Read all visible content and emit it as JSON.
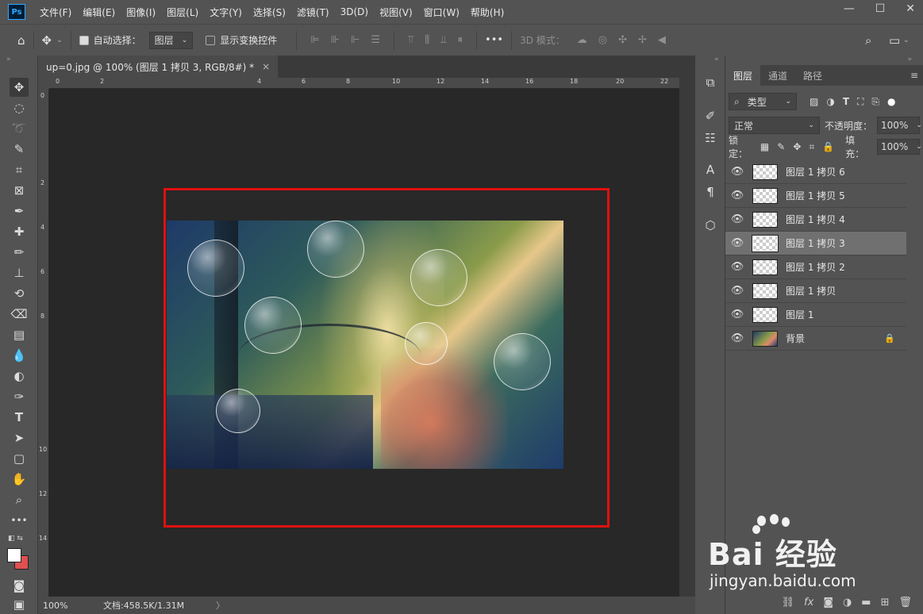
{
  "app": {
    "logo": "Ps"
  },
  "menu": [
    "文件(F)",
    "编辑(E)",
    "图像(I)",
    "图层(L)",
    "文字(Y)",
    "选择(S)",
    "滤镜(T)",
    "3D(D)",
    "视图(V)",
    "窗口(W)",
    "帮助(H)"
  ],
  "window_controls": {
    "minimize": "—",
    "restore": "☐",
    "close": "✕"
  },
  "options": {
    "auto_select_label": "自动选择：",
    "auto_select_checked": true,
    "auto_select_target": "图层",
    "show_transform_label": "显示变换控件",
    "show_transform_checked": false,
    "mode_3d_label": "3D 模式："
  },
  "document": {
    "tab_title": "up=0.jpg @ 100% (图层 1 拷贝 3, RGB/8#) *",
    "tab_close": "×",
    "ruler_h": [
      "0",
      "2",
      "4",
      "6",
      "8",
      "10",
      "12",
      "14",
      "16",
      "18",
      "20",
      "22"
    ],
    "ruler_v": [
      "0",
      "2",
      "4",
      "6",
      "8",
      "10",
      "12",
      "14"
    ],
    "zoom": "100%",
    "doc_info": "文档:458.5K/1.31M",
    "status_arrow": "〉"
  },
  "panel": {
    "tabs": [
      "图层",
      "通道",
      "路径"
    ],
    "active_tab": "图层",
    "filter_kind": "类型",
    "blend_mode": "正常",
    "opacity_label": "不透明度：",
    "opacity_value": "100%",
    "lock_label": "锁定：",
    "fill_label": "填充：",
    "fill_value": "100%",
    "layers": [
      {
        "name": "图层 1 拷贝 6",
        "visible": true,
        "selected": false,
        "locked": false,
        "thumb": "transparent"
      },
      {
        "name": "图层 1 拷贝 5",
        "visible": true,
        "selected": false,
        "locked": false,
        "thumb": "transparent"
      },
      {
        "name": "图层 1 拷贝 4",
        "visible": true,
        "selected": false,
        "locked": false,
        "thumb": "transparent"
      },
      {
        "name": "图层 1 拷贝 3",
        "visible": true,
        "selected": true,
        "locked": false,
        "thumb": "transparent"
      },
      {
        "name": "图层 1 拷贝 2",
        "visible": true,
        "selected": false,
        "locked": false,
        "thumb": "transparent"
      },
      {
        "name": "图层 1 拷贝",
        "visible": true,
        "selected": false,
        "locked": false,
        "thumb": "transparent"
      },
      {
        "name": "图层 1",
        "visible": true,
        "selected": false,
        "locked": false,
        "thumb": "transparent"
      },
      {
        "name": "背景",
        "visible": true,
        "selected": false,
        "locked": true,
        "thumb": "photo"
      }
    ]
  },
  "watermark": {
    "brand": "Bai 经验",
    "url": "jingyan.baidu.com"
  },
  "colors": {
    "highlight_box": "#e01010",
    "foreground": "#ffffff",
    "background": "#e05050"
  }
}
